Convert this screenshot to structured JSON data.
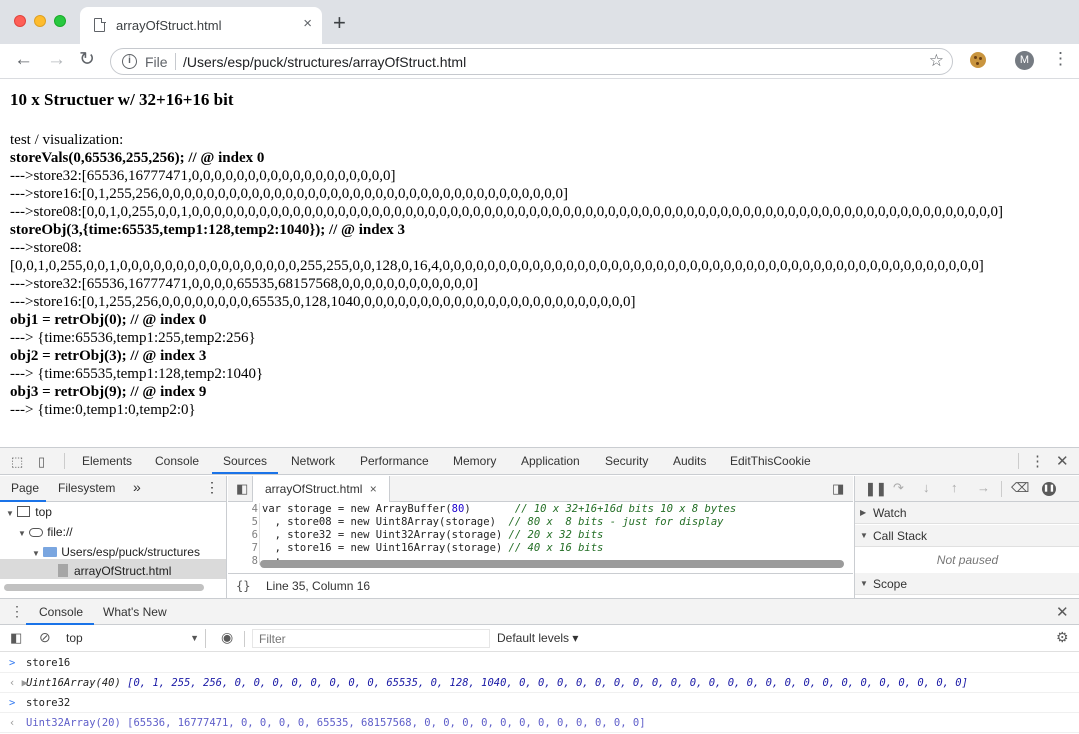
{
  "browser": {
    "tab_title": "arrayOfStruct.html",
    "tab_close": "×",
    "new_tab": "+",
    "omnibox_scheme": "File",
    "omnibox_url": "/Users/esp/puck/structures/arrayOfStruct.html",
    "avatar_letter": "M",
    "icons": [
      "back-icon",
      "forward-icon",
      "reload-icon",
      "info-icon",
      "star-icon",
      "cookie-icon",
      "kebab-icon"
    ]
  },
  "page": {
    "heading": "10 x Structuer w/ 32+16+16 bit",
    "lines": [
      {
        "text": "test / visualization:",
        "bold": false
      },
      {
        "text": "storeVals(0,65536,255,256); // @ index 0",
        "bold": true
      },
      {
        "text": "--->store32:[65536,16777471,0,0,0,0,0,0,0,0,0,0,0,0,0,0,0,0,0,0]",
        "bold": false
      },
      {
        "text": "--->store16:[0,1,255,256,0,0,0,0,0,0,0,0,0,0,0,0,0,0,0,0,0,0,0,0,0,0,0,0,0,0,0,0,0,0,0,0,0,0,0,0]",
        "bold": false
      },
      {
        "text": "--->store08:[0,0,1,0,255,0,0,1,0,0,0,0,0,0,0,0,0,0,0,0,0,0,0,0,0,0,0,0,0,0,0,0,0,0,0,0,0,0,0,0,0,0,0,0,0,0,0,0,0,0,0,0,0,0,0,0,0,0,0,0,0,0,0,0,0,0,0,0,0,0,0,0,0,0,0,0,0,0,0,0]",
        "bold": false
      },
      {
        "text": "storeObj(3,{time:65535,temp1:128,temp2:1040}); // @ index 3",
        "bold": true
      },
      {
        "text": "--->store08:",
        "bold": false
      },
      {
        "text": "[0,0,1,0,255,0,0,1,0,0,0,0,0,0,0,0,0,0,0,0,0,0,0,0,255,255,0,0,128,0,16,4,0,0,0,0,0,0,0,0,0,0,0,0,0,0,0,0,0,0,0,0,0,0,0,0,0,0,0,0,0,0,0,0,0,0,0,0,0,0,0,0,0,0,0,0,0,0,0,0]",
        "bold": false
      },
      {
        "text": "--->store32:[65536,16777471,0,0,0,0,65535,68157568,0,0,0,0,0,0,0,0,0,0,0,0]",
        "bold": false
      },
      {
        "text": "--->store16:[0,1,255,256,0,0,0,0,0,0,0,0,65535,0,128,1040,0,0,0,0,0,0,0,0,0,0,0,0,0,0,0,0,0,0,0,0,0,0,0,0]",
        "bold": false
      },
      {
        "text": "obj1 = retrObj(0); // @ index 0",
        "bold": true
      },
      {
        "text": "---> {time:65536,temp1:255,temp2:256}",
        "bold": false
      },
      {
        "text": "obj2 = retrObj(3); // @ index 3",
        "bold": true
      },
      {
        "text": "---> {time:65535,temp1:128,temp2:1040}",
        "bold": false
      },
      {
        "text": "obj3 = retrObj(9); // @ index 9",
        "bold": true
      },
      {
        "text": "---> {time:0,temp1:0,temp2:0}",
        "bold": false
      }
    ]
  },
  "devtools": {
    "tabs": [
      "Elements",
      "Console",
      "Sources",
      "Network",
      "Performance",
      "Memory",
      "Application",
      "Security",
      "Audits",
      "EditThisCookie"
    ],
    "active_tab": "Sources",
    "navigator": {
      "tabs": [
        "Page",
        "Filesystem",
        "»"
      ],
      "tree": [
        "top",
        "file://",
        "Users/esp/puck/structures",
        "arrayOfStruct.html"
      ]
    },
    "editor": {
      "file_tab": "arrayOfStruct.html",
      "file_tab_close": "×",
      "line_numbers": [
        "4",
        "5",
        "6",
        "7",
        "8"
      ],
      "code_lines": [
        {
          "pre": "var storage = new ArrayBuffer(",
          "num": "80",
          "post": ")       ",
          "comment": "// 10 x 32+16+16d bits 10 x 8 bytes"
        },
        {
          "pre": "  , store08 = new Uint8Array(storage)  ",
          "num": "",
          "post": "",
          "comment": "// 80 x  8 bits - just for display"
        },
        {
          "pre": "  , store32 = new Uint32Array(storage) ",
          "num": "",
          "post": "",
          "comment": "// 20 x 32 bits"
        },
        {
          "pre": "  , store16 = new Uint16Array(storage) ",
          "num": "",
          "post": "",
          "comment": "// 40 x 16 bits"
        },
        {
          "pre": "  ;",
          "num": "",
          "post": "",
          "comment": ""
        }
      ],
      "status_braces": "{}",
      "status": "Line 35, Column 16"
    },
    "debugger": {
      "sections": [
        {
          "label": "Watch",
          "open": false
        },
        {
          "label": "Call Stack",
          "open": true
        },
        {
          "label": "Scope",
          "open": true
        }
      ],
      "call_stack_state": "Not paused"
    },
    "drawer": {
      "tabs": [
        "Console",
        "What's New"
      ],
      "active_tab": "Console",
      "context": "top",
      "filter_placeholder": "Filter",
      "levels": "Default levels ▾",
      "lines": [
        {
          "kind": "in",
          "prefix": ">",
          "text": "store16"
        },
        {
          "kind": "out",
          "prefix": "‹ ▶",
          "type": "Uint16Array(40)",
          "value": "[0, 1, 255, 256, 0, 0, 0, 0, 0, 0, 0, 0, 65535, 0, 128, 1040, 0, 0, 0, 0, 0, 0, 0, 0, 0, 0, 0, 0, 0, 0, 0, 0, 0, 0, 0, 0, 0, 0, 0, 0]"
        },
        {
          "kind": "in",
          "prefix": ">",
          "text": "store32"
        },
        {
          "kind": "out-plain",
          "prefix": "‹",
          "type": "Uint32Array(20)",
          "value": "[65536, 16777471, 0, 0, 0, 0, 65535, 68157568, 0, 0, 0, 0, 0, 0, 0, 0, 0, 0, 0, 0]"
        }
      ]
    }
  }
}
